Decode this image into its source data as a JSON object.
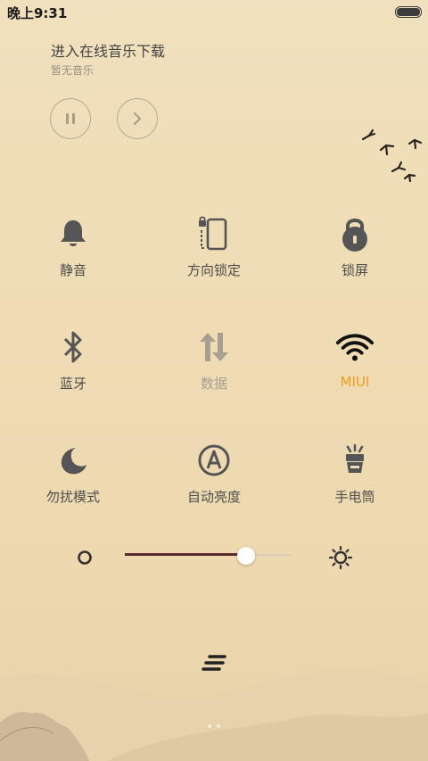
{
  "status_bar": {
    "time": "晚上9:31"
  },
  "music": {
    "title": "进入在线音乐下载",
    "subtitle": "暂无音乐"
  },
  "toggles": [
    {
      "label": "静音",
      "icon": "bell-icon",
      "state": "normal"
    },
    {
      "label": "方向锁定",
      "icon": "rotation-lock-icon",
      "state": "normal"
    },
    {
      "label": "锁屏",
      "icon": "lock-icon",
      "state": "normal"
    },
    {
      "label": "蓝牙",
      "icon": "bluetooth-icon",
      "state": "normal"
    },
    {
      "label": "数据",
      "icon": "data-icon",
      "state": "disabled"
    },
    {
      "label": "MIUI",
      "icon": "wifi-icon",
      "state": "active"
    },
    {
      "label": "勿扰模式",
      "icon": "moon-icon",
      "state": "normal"
    },
    {
      "label": "自动亮度",
      "icon": "auto-brightness-icon",
      "state": "normal"
    },
    {
      "label": "手电筒",
      "icon": "flashlight-icon",
      "state": "normal"
    }
  ],
  "brightness": {
    "level": 0.73
  },
  "colors": {
    "active": "#f29a1b",
    "slider_fill": "#5a2b28",
    "background": "#efdcb4"
  },
  "pager": {
    "pages": 2,
    "current": 1
  }
}
